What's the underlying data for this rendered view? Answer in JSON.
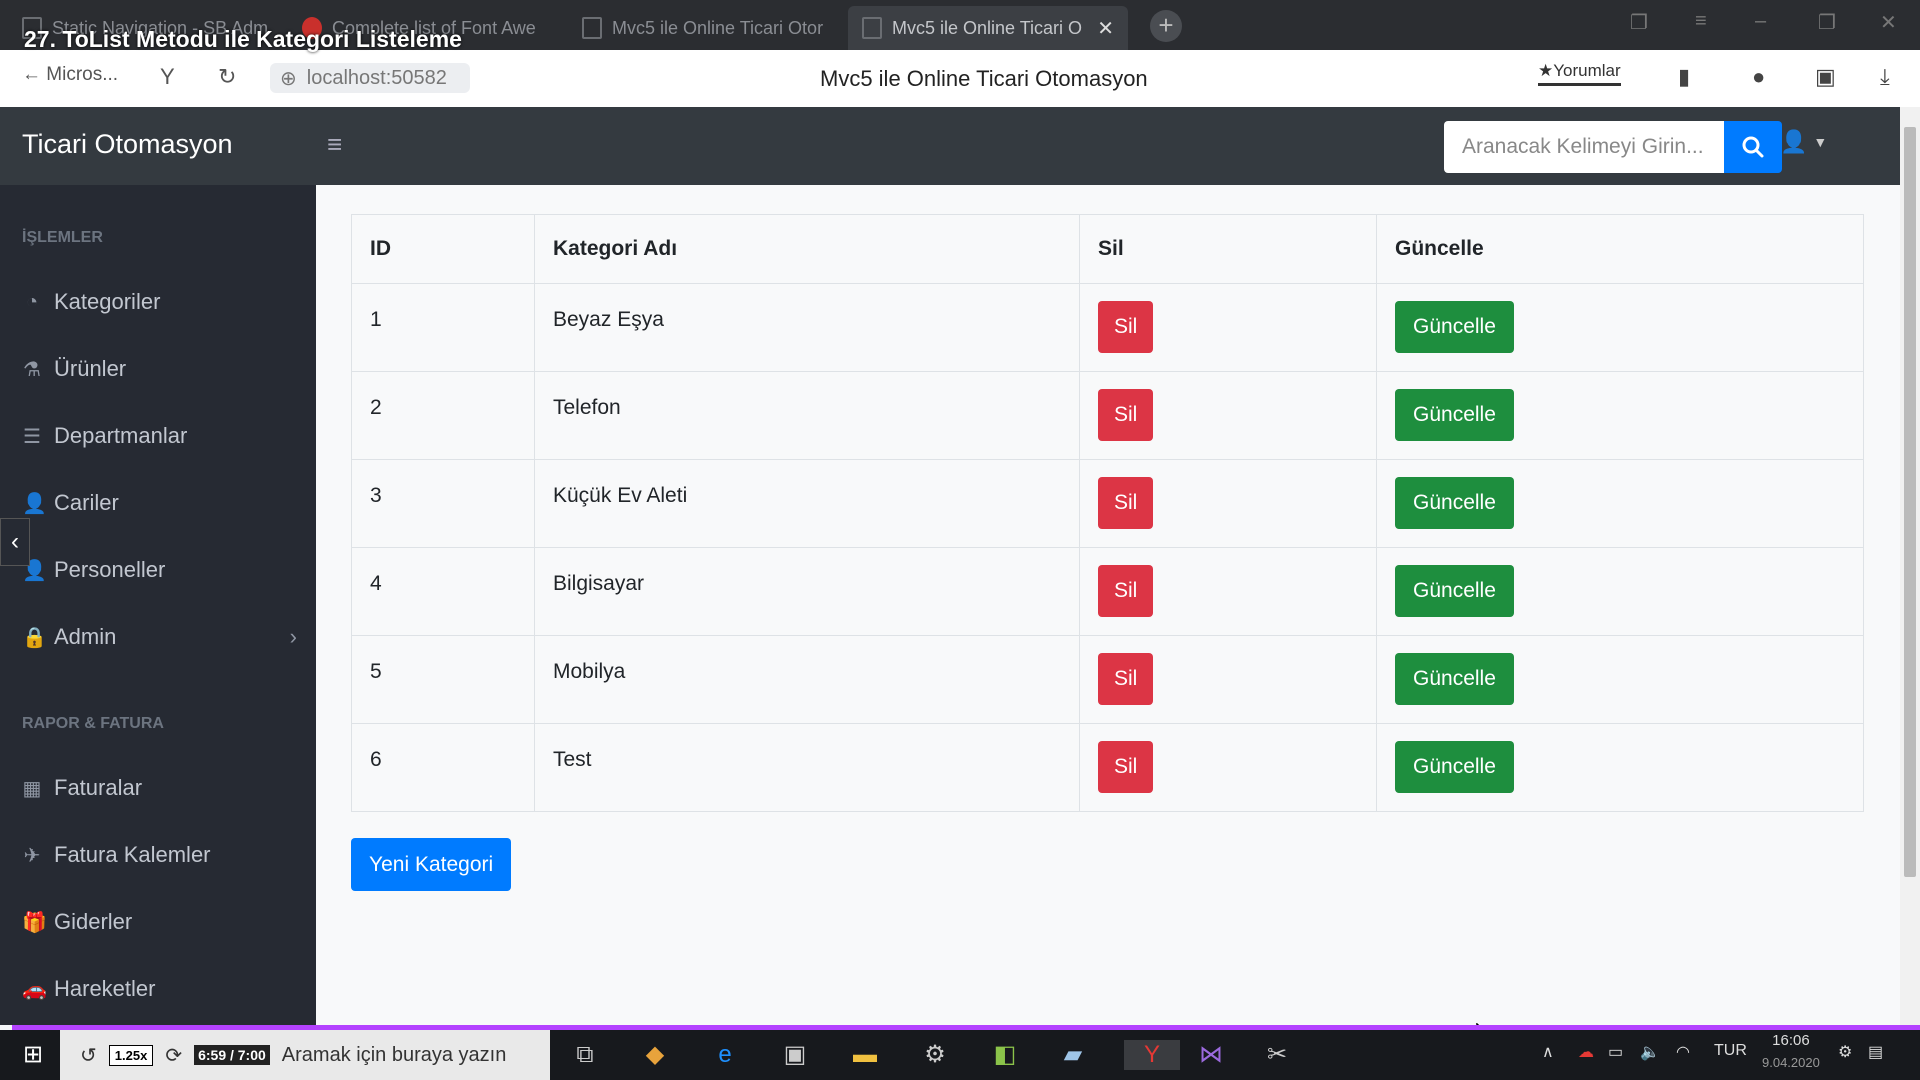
{
  "video_overlay": {
    "title": "27. ToList Metodu ile Kategori Listeleme"
  },
  "browser": {
    "tabs": [
      {
        "label": "Static Navigation - SB Adm"
      },
      {
        "label": "Complete list of Font Awe"
      },
      {
        "label": "Mvc5 ile Online Ticari Otor"
      },
      {
        "label": "Mvc5 ile Online Ticari O"
      }
    ],
    "back_label": "Micros...",
    "url": "localhost:50582",
    "page_title": "Mvc5 ile Online Ticari Otomasyon",
    "reviews_label": "Yorumlar"
  },
  "navbar": {
    "brand": "Ticari Otomasyon",
    "search_placeholder": "Aranacak Kelimeyi Girin..."
  },
  "sidebar": {
    "sections": [
      {
        "heading": "İŞLEMLER"
      },
      {
        "heading": "RAPOR & FATURA"
      }
    ],
    "items": [
      {
        "label": "Kategoriler",
        "icon": "tachometer-icon"
      },
      {
        "label": "Ürünler",
        "icon": "flask-icon"
      },
      {
        "label": "Departmanlar",
        "icon": "list-icon"
      },
      {
        "label": "Cariler",
        "icon": "user-icon"
      },
      {
        "label": "Personeller",
        "icon": "user-tie-icon"
      },
      {
        "label": "Admin",
        "icon": "lock-icon"
      },
      {
        "label": "Faturalar",
        "icon": "calendar-icon"
      },
      {
        "label": "Fatura Kalemler",
        "icon": "plane-icon"
      },
      {
        "label": "Giderler",
        "icon": "gift-icon"
      },
      {
        "label": "Hareketler",
        "icon": "car-icon"
      }
    ]
  },
  "table": {
    "headers": [
      "ID",
      "Kategori Adı",
      "Sil",
      "Güncelle"
    ],
    "rows": [
      {
        "id": "1",
        "name": "Beyaz Eşya",
        "delete": "Sil",
        "update": "Güncelle"
      },
      {
        "id": "2",
        "name": "Telefon",
        "delete": "Sil",
        "update": "Güncelle"
      },
      {
        "id": "3",
        "name": "Küçük Ev Aleti",
        "delete": "Sil",
        "update": "Güncelle"
      },
      {
        "id": "4",
        "name": "Bilgisayar",
        "delete": "Sil",
        "update": "Güncelle"
      },
      {
        "id": "5",
        "name": "Mobilya",
        "delete": "Sil",
        "update": "Güncelle"
      },
      {
        "id": "6",
        "name": "Test",
        "delete": "Sil",
        "update": "Güncelle"
      }
    ]
  },
  "new_category_button": "Yeni Kategori",
  "taskbar": {
    "search_text": "Aramak için buraya yazın",
    "playback_speed": "1.25x",
    "playback_time": "6:59 / 7:00",
    "language": "TUR",
    "time": "16:06",
    "date": "9.04.2020"
  },
  "colors": {
    "navbar": "#343a40",
    "sidebar": "#262a33",
    "primary": "#007bff",
    "danger": "#dc3545",
    "success": "#1e8e3e"
  }
}
